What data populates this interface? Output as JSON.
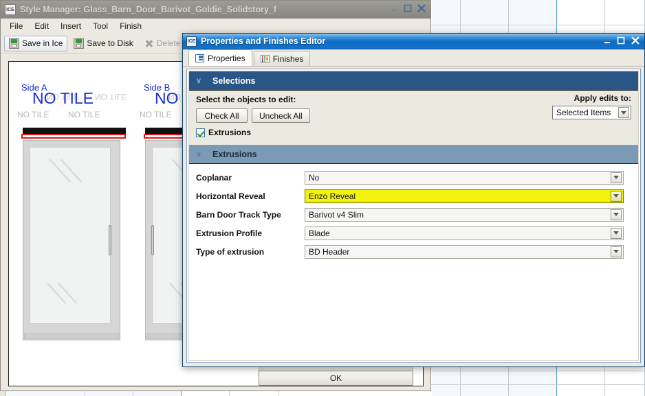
{
  "main_window": {
    "icon_label": "ICE",
    "title": "Style Manager: Glass_Barn_Door_Barivot_Goldie_Solidstory_f",
    "menu": [
      "File",
      "Edit",
      "Insert",
      "Tool",
      "Finish"
    ],
    "toolbar": {
      "save_in_ice": "Save in Ice",
      "save_to_disk": "Save to Disk",
      "delete": "Delete"
    },
    "ok_button": "OK",
    "canvas": {
      "side_a_label": "Side A",
      "side_b_label": "Side B",
      "no_tile_big": "NO TILE",
      "no_tile_small": "NO TILE",
      "no_tile_flipped": "NO TILE"
    },
    "window_controls": {
      "minimize": "minimize",
      "maximize": "maximize",
      "close": "close"
    }
  },
  "dialog": {
    "icon_label": "ICE",
    "title": "Properties and Finishes Editor",
    "window_controls": {
      "minimize": "minimize",
      "maximize": "maximize",
      "close": "close"
    },
    "tabs": [
      {
        "label": "Properties",
        "icon": "list-icon",
        "active": true
      },
      {
        "label": "Finishes",
        "icon": "color-swatch-icon",
        "active": false
      }
    ],
    "selections": {
      "header": "Selections",
      "chevron": "∨",
      "instruction": "Select the objects to edit:",
      "check_all": "Check All",
      "uncheck_all": "Uncheck All",
      "apply_edits_label": "Apply edits to:",
      "apply_edits_value": "Selected Items",
      "checkbox_label": "Extrusions",
      "checkbox_checked": true
    },
    "extrusions": {
      "header": "Extrusions",
      "chevron": "∨",
      "rows": [
        {
          "label": "Coplanar",
          "value": "No",
          "highlighted": false
        },
        {
          "label": "Horizontal Reveal",
          "value": "Enzo Reveal",
          "highlighted": true
        },
        {
          "label": "Barn Door Track Type",
          "value": "Barivot v4 Slim",
          "highlighted": false
        },
        {
          "label": "Extrusion Profile",
          "value": "Blade",
          "highlighted": false
        },
        {
          "label": "Type of extrusion",
          "value": "BD Header",
          "highlighted": false
        }
      ]
    }
  },
  "colors": {
    "selections_header_bg": "#2a5685",
    "extrusions_header_bg": "#7b9ab5",
    "highlight_yellow": "#f2f20c",
    "dialog_titlebar_blue": "#1372c8",
    "accent_blue_text": "#1a2fd0",
    "reveal_red": "#e81414"
  }
}
